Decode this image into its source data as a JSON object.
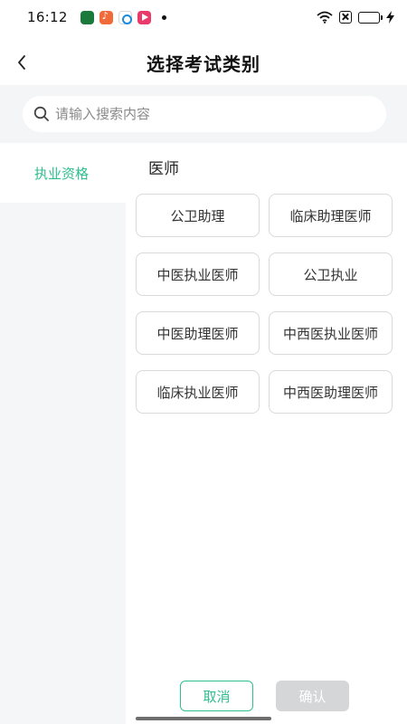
{
  "status_bar": {
    "time": "16:12",
    "notification_icons": [
      "green-app-icon",
      "music-app-icon",
      "blue-circle-app-icon",
      "video-app-icon"
    ]
  },
  "header": {
    "title": "选择考试类别",
    "back_icon": "chevron-left-icon"
  },
  "search": {
    "placeholder": "请输入搜索内容",
    "value": "",
    "icon": "search-icon"
  },
  "sidebar": {
    "items": [
      {
        "label": "执业资格",
        "selected": true
      }
    ]
  },
  "main": {
    "section_title": "医师",
    "options": [
      "公卫助理",
      "临床助理医师",
      "中医执业医师",
      "公卫执业",
      "中医助理医师",
      "中西医执业医师",
      "临床执业医师",
      "中西医助理医师"
    ]
  },
  "footer": {
    "cancel_label": "取消",
    "confirm_label": "确认",
    "confirm_enabled": false
  },
  "colors": {
    "accent": "#2fbf8e",
    "disabled": "#d4d6d8",
    "sidebar_bg": "#f5f6f8"
  }
}
